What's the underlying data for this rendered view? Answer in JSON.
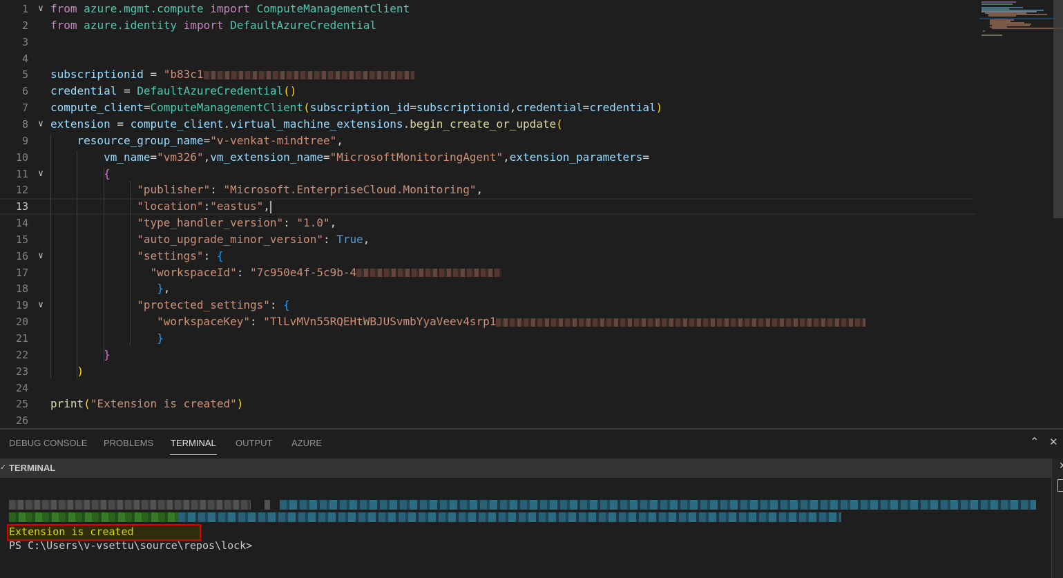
{
  "editor": {
    "lines": [
      {
        "n": "1",
        "fold": true,
        "tokens": [
          [
            "kw",
            "from"
          ],
          [
            "op",
            " "
          ],
          [
            "mod",
            "azure.mgmt.compute"
          ],
          [
            "op",
            " "
          ],
          [
            "kw",
            "import"
          ],
          [
            "op",
            " "
          ],
          [
            "cls",
            "ComputeManagementClient"
          ]
        ]
      },
      {
        "n": "2",
        "tokens": [
          [
            "kw",
            "from"
          ],
          [
            "op",
            " "
          ],
          [
            "mod",
            "azure.identity"
          ],
          [
            "op",
            " "
          ],
          [
            "kw",
            "import"
          ],
          [
            "op",
            " "
          ],
          [
            "cls",
            "DefaultAzureCredential"
          ]
        ]
      },
      {
        "n": "3",
        "tokens": []
      },
      {
        "n": "4",
        "tokens": []
      },
      {
        "n": "5",
        "tokens": [
          [
            "var",
            "subscriptionid"
          ],
          [
            "op",
            " = "
          ],
          [
            "str",
            "\"b83c1"
          ],
          [
            "blur",
            "redacted"
          ]
        ]
      },
      {
        "n": "6",
        "tokens": [
          [
            "var",
            "credential"
          ],
          [
            "op",
            " = "
          ],
          [
            "cls",
            "DefaultAzureCredential"
          ],
          [
            "br1",
            "()"
          ]
        ]
      },
      {
        "n": "7",
        "tokens": [
          [
            "var",
            "compute_client"
          ],
          [
            "op",
            "="
          ],
          [
            "cls",
            "ComputeManagementClient"
          ],
          [
            "br1",
            "("
          ],
          [
            "var",
            "subscription_id"
          ],
          [
            "op",
            "="
          ],
          [
            "var",
            "subscriptionid"
          ],
          [
            "op",
            ","
          ],
          [
            "var",
            "credential"
          ],
          [
            "op",
            "="
          ],
          [
            "var",
            "credential"
          ],
          [
            "br1",
            ")"
          ]
        ]
      },
      {
        "n": "8",
        "fold": true,
        "tokens": [
          [
            "var",
            "extension"
          ],
          [
            "op",
            " = "
          ],
          [
            "var",
            "compute_client"
          ],
          [
            "op",
            "."
          ],
          [
            "var",
            "virtual_machine_extensions"
          ],
          [
            "op",
            "."
          ],
          [
            "fn",
            "begin_create_or_update"
          ],
          [
            "br1",
            "("
          ]
        ]
      },
      {
        "n": "9",
        "tokens": [
          [
            "op",
            "    "
          ],
          [
            "var",
            "resource_group_name"
          ],
          [
            "op",
            "="
          ],
          [
            "str",
            "\"v-venkat-mindtree\""
          ],
          [
            "op",
            ","
          ]
        ]
      },
      {
        "n": "10",
        "tokens": [
          [
            "op",
            "        "
          ],
          [
            "var",
            "vm_name"
          ],
          [
            "op",
            "="
          ],
          [
            "str",
            "\"vm326\""
          ],
          [
            "op",
            ","
          ],
          [
            "var",
            "vm_extension_name"
          ],
          [
            "op",
            "="
          ],
          [
            "str",
            "\"MicrosoftMonitoringAgent\""
          ],
          [
            "op",
            ","
          ],
          [
            "var",
            "extension_parameters"
          ],
          [
            "op",
            "="
          ]
        ]
      },
      {
        "n": "11",
        "fold": true,
        "tokens": [
          [
            "op",
            "        "
          ],
          [
            "br2",
            "{"
          ]
        ]
      },
      {
        "n": "12",
        "tokens": [
          [
            "op",
            "             "
          ],
          [
            "str",
            "\"publisher\""
          ],
          [
            "op",
            ": "
          ],
          [
            "str",
            "\"Microsoft.EnterpriseCloud.Monitoring\""
          ],
          [
            "op",
            ","
          ]
        ]
      },
      {
        "n": "13",
        "current": true,
        "tokens": [
          [
            "op",
            "             "
          ],
          [
            "str",
            "\"location\""
          ],
          [
            "op",
            ":"
          ],
          [
            "str",
            "\"eastus\""
          ],
          [
            "op",
            ","
          ],
          [
            "cursor",
            ""
          ]
        ]
      },
      {
        "n": "14",
        "tokens": [
          [
            "op",
            "             "
          ],
          [
            "str",
            "\"type_handler_version\""
          ],
          [
            "op",
            ": "
          ],
          [
            "str",
            "\"1.0\""
          ],
          [
            "op",
            ","
          ]
        ]
      },
      {
        "n": "15",
        "tokens": [
          [
            "op",
            "             "
          ],
          [
            "str",
            "\"auto_upgrade_minor_version\""
          ],
          [
            "op",
            ": "
          ],
          [
            "bool",
            "True"
          ],
          [
            "op",
            ","
          ]
        ]
      },
      {
        "n": "16",
        "fold": true,
        "tokens": [
          [
            "op",
            "             "
          ],
          [
            "str",
            "\"settings\""
          ],
          [
            "op",
            ": "
          ],
          [
            "br3",
            "{"
          ]
        ]
      },
      {
        "n": "17",
        "tokens": [
          [
            "op",
            "               "
          ],
          [
            "str",
            "\"workspaceId\""
          ],
          [
            "op",
            ": "
          ],
          [
            "str",
            "\"7c950e4f-5c9b-4"
          ],
          [
            "blur",
            "redacted"
          ]
        ]
      },
      {
        "n": "18",
        "tokens": [
          [
            "op",
            "                "
          ],
          [
            "br3",
            "}"
          ],
          [
            "op",
            ","
          ]
        ]
      },
      {
        "n": "19",
        "fold": true,
        "tokens": [
          [
            "op",
            "             "
          ],
          [
            "str",
            "\"protected_settings\""
          ],
          [
            "op",
            ": "
          ],
          [
            "br3",
            "{"
          ]
        ]
      },
      {
        "n": "20",
        "tokens": [
          [
            "op",
            "                "
          ],
          [
            "str",
            "\"workspaceKey\""
          ],
          [
            "op",
            ": "
          ],
          [
            "str",
            "\"TlLvMVn55RQEHtWBJUSvmbYyaVeev4srp1"
          ],
          [
            "blur",
            "redacted"
          ]
        ]
      },
      {
        "n": "21",
        "tokens": [
          [
            "op",
            "                "
          ],
          [
            "br3",
            "}"
          ]
        ]
      },
      {
        "n": "22",
        "tokens": [
          [
            "op",
            "        "
          ],
          [
            "br2",
            "}"
          ]
        ]
      },
      {
        "n": "23",
        "tokens": [
          [
            "op",
            "    "
          ],
          [
            "br1",
            ")"
          ]
        ]
      },
      {
        "n": "24",
        "tokens": []
      },
      {
        "n": "25",
        "tokens": [
          [
            "fn",
            "print"
          ],
          [
            "br1",
            "("
          ],
          [
            "str",
            "\"Extension is created\""
          ],
          [
            "br1",
            ")"
          ]
        ]
      },
      {
        "n": "26",
        "tokens": []
      }
    ]
  },
  "panel": {
    "tabs": [
      {
        "label": "DEBUG CONSOLE",
        "active": false
      },
      {
        "label": "PROBLEMS",
        "active": false
      },
      {
        "label": "TERMINAL",
        "active": true
      },
      {
        "label": "OUTPUT",
        "active": false
      },
      {
        "label": "AZURE",
        "active": false
      }
    ],
    "maximize_icon": "chevron-up-icon",
    "close_icon": "close-icon",
    "terminal_section_title": "TERMINAL",
    "terminal": {
      "output_line": "Extension is created",
      "prompt": "PS C:\\Users\\v-vsettu\\source\\repos\\lock>"
    }
  },
  "colors": {
    "highlight_border": "#e00000",
    "output_text": "#d7d700"
  }
}
